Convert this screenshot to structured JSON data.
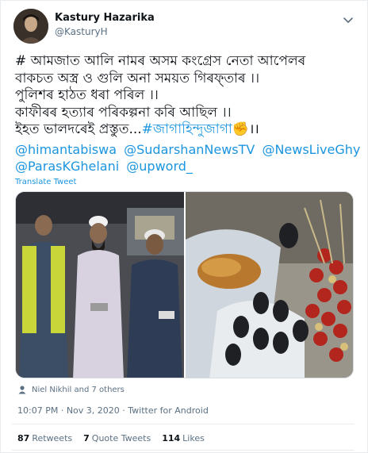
{
  "author": {
    "name": "Kastury Hazarika",
    "handle": "@KasturyH"
  },
  "tweet": {
    "lines": [
      "# আমজাত আলি নামৰ অসম কংগ্ৰেস নেতা আপেলৰ",
      "বাকচত অস্ত্ৰ ও গুলি অনা সময়ত গিৰফ্তাৰ ।।",
      "পুলিশৰ হাঠত ধৰা পৰিল ।।",
      "কাফীৰৰ হত্যাৰ পৰিকল্পনা কৰি আছিল ।।",
      "ইহত ভালদৰেই প্ৰস্তুত...",
      "#জাগাহিন্দুজাগা",
      "✊",
      "।।"
    ],
    "mentions": [
      "@himantabiswa",
      "@SudarshanNewsTV",
      "@NewsLiveGhy",
      "@ParasKGhelani",
      "@upword_"
    ],
    "translate": "Translate Tweet"
  },
  "likers": "Niel Nikhil and 7 others",
  "meta": {
    "time": "10:07 PM",
    "date": "Nov 3, 2020",
    "source": "Twitter for Android",
    "separator": "·"
  },
  "stats": {
    "retweets_count": "87",
    "retweets_label": "Retweets",
    "quotes_count": "7",
    "quotes_label": "Quote Tweets",
    "likes_count": "114",
    "likes_label": "Likes"
  },
  "icons": {
    "caret": "chevron-down-icon",
    "likers": "person-icon"
  }
}
